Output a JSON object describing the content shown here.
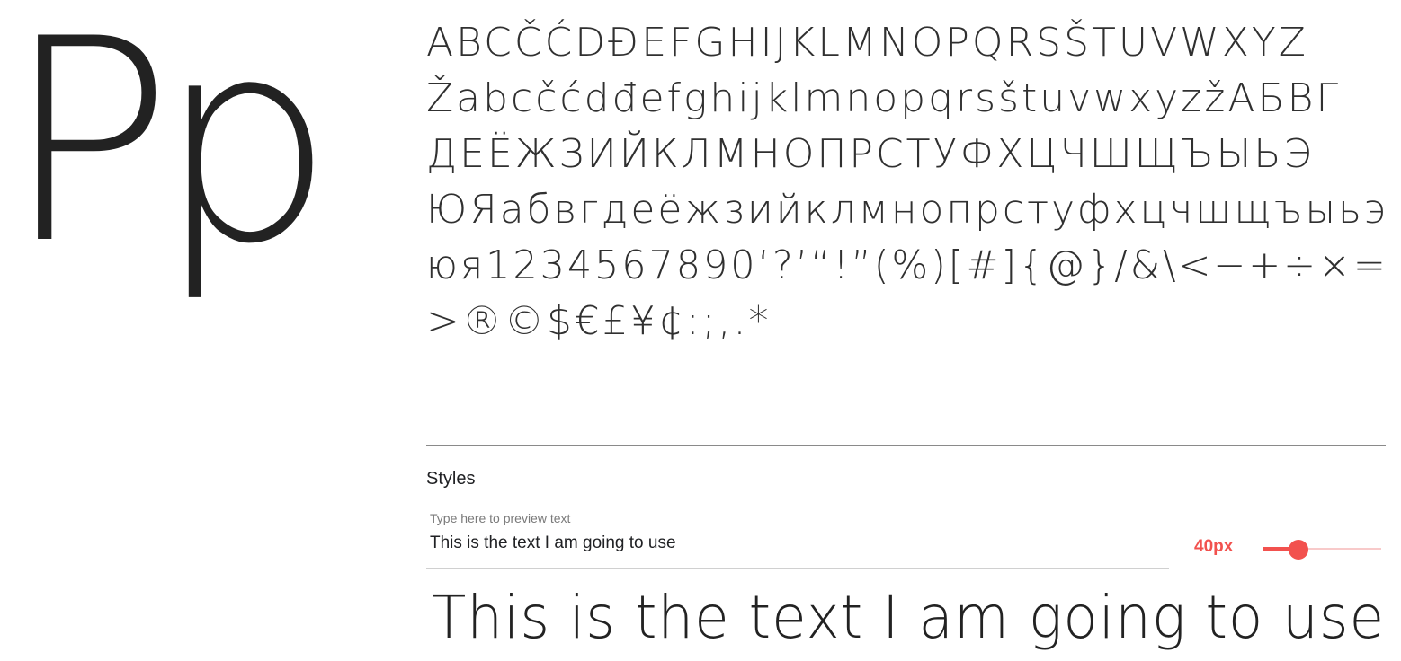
{
  "specimen": {
    "big_letters": "Pp",
    "glyph_lines": [
      "ABCČĆDĐEFGHIJKLMNOPQRSŠTUVWXYZ",
      "ŽabcčćdđefghijklmnopqrsštuvwxyzžАБВГ",
      "ДЕЁЖЗИЙКЛМНОПРСТУФХЦЧШЩЪЫЬЭ",
      "ЮЯабвгдеёжзийклмнопрстуфхцчшщъыьэ",
      "юя1234567890‘?’“!”(%)[#]{@}/&\\<−+÷×=",
      ">®©$€£¥¢:;,.*"
    ]
  },
  "styles": {
    "title": "Styles",
    "preview_label": "Type here to preview text",
    "preview_value": "This is the text I am going to use",
    "size_label": "40px",
    "size_slider_level": 0.3
  },
  "preview": {
    "output_text": "This is the text I am going to use"
  },
  "colors": {
    "accent": "#f2514e",
    "accent_light": "#f8caca",
    "divider": "#8a8a8a",
    "text": "#202124"
  }
}
